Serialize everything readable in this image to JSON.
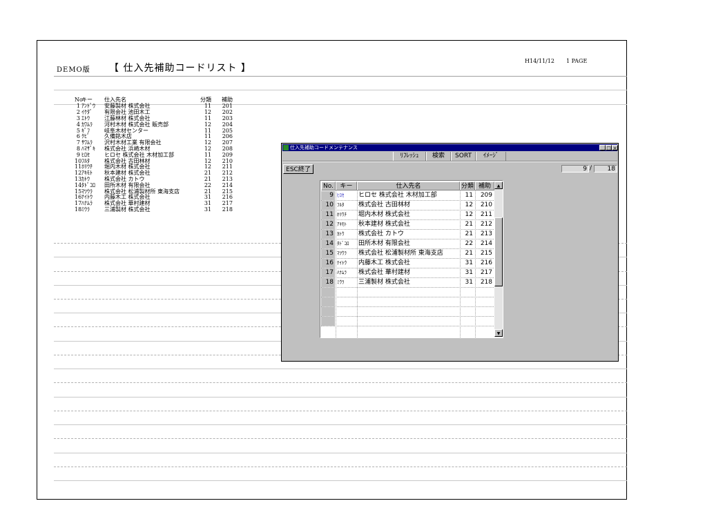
{
  "report": {
    "demo_label": "DEMO版",
    "title": "【 仕入先補助コードリスト 】",
    "date": "H14/11/12",
    "page": "1 PAGE",
    "headers": {
      "no": "No",
      "key": "キー",
      "name": "仕入先名",
      "bunrui": "分類",
      "hojo": "補助"
    },
    "rows": [
      {
        "no": "1",
        "key": "ｱﾝﾄﾞｳ",
        "name": "安藤製材 株式会社",
        "bunrui": "11",
        "hojo": "201"
      },
      {
        "no": "2",
        "key": "ｲｹﾀﾞ",
        "name": "有限会社 池田木工",
        "bunrui": "12",
        "hojo": "202"
      },
      {
        "no": "3",
        "key": "ｴﾄｳ",
        "name": "江藤林材 株式会社",
        "bunrui": "11",
        "hojo": "203"
      },
      {
        "no": "4",
        "key": "ｶﾜﾑﾗ",
        "name": "河村木材 株式会社 販売部",
        "bunrui": "12",
        "hojo": "204"
      },
      {
        "no": "5",
        "key": "ｷﾞﾌ",
        "name": "岐阜木材センター",
        "bunrui": "11",
        "hojo": "205"
      },
      {
        "no": "6",
        "key": "ｸﾋﾞ",
        "name": "久備銘木店",
        "bunrui": "11",
        "hojo": "206"
      },
      {
        "no": "7",
        "key": "ｻﾜﾑﾗ",
        "name": "沢村木材工業 有限会社",
        "bunrui": "12",
        "hojo": "207"
      },
      {
        "no": "8",
        "key": "ﾊﾏｻﾞｷ",
        "name": "株式会社 浜崎木材",
        "bunrui": "12",
        "hojo": "208"
      },
      {
        "no": "9",
        "key": "ﾋﾛｾ",
        "name": "ヒロセ 株式会社 木材加工部",
        "bunrui": "11",
        "hojo": "209"
      },
      {
        "no": "10",
        "key": "ﾌﾙﾀ",
        "name": "株式会社 古田林材",
        "bunrui": "12",
        "hojo": "210"
      },
      {
        "no": "11",
        "key": "ﾎﾘｳﾁ",
        "name": "堀内木材 株式会社",
        "bunrui": "12",
        "hojo": "211"
      },
      {
        "no": "12",
        "key": "ｱｷﾓﾄ",
        "name": "秋本建材 株式会社",
        "bunrui": "21",
        "hojo": "212"
      },
      {
        "no": "13",
        "key": "ｶﾄｳ",
        "name": "株式会社 カトウ",
        "bunrui": "21",
        "hojo": "213"
      },
      {
        "no": "14",
        "key": "ﾀﾄﾞｺﾛ",
        "name": "田所木材 有限会社",
        "bunrui": "22",
        "hojo": "214"
      },
      {
        "no": "15",
        "key": "ﾏﾂｳﾗ",
        "name": "株式会社 松浦製材所 東海支店",
        "bunrui": "21",
        "hojo": "215"
      },
      {
        "no": "16",
        "key": "ﾅｲﾄｳ",
        "name": "内藤木工 株式会社",
        "bunrui": "31",
        "hojo": "216"
      },
      {
        "no": "17",
        "key": "ﾊﾅﾑﾗ",
        "name": "株式会社 華村建材",
        "bunrui": "31",
        "hojo": "217"
      },
      {
        "no": "18",
        "key": "ﾐｳﾗ",
        "name": "三浦製材 株式会社",
        "bunrui": "31",
        "hojo": "218"
      }
    ]
  },
  "window": {
    "title": "仕入先補助コードメンテナンス",
    "buttons": {
      "minimize": "_",
      "maximize": "□",
      "close": "×"
    },
    "toolbar": [
      "ﾘﾌﾚｯｼｭ",
      "検索",
      "SORT",
      "ｲﾒｰｼﾞ"
    ],
    "esc_label": "ESC終了",
    "current": "9",
    "slash": "/",
    "total": "18",
    "grid": {
      "headers": {
        "no": "No.",
        "key": "キー",
        "name": "仕入先名",
        "bunrui": "分類",
        "hojo": "補助"
      },
      "rows": [
        {
          "no": "9",
          "key": "ﾋﾛｾ",
          "name": "ヒロセ 株式会社 木材加工部",
          "bunrui": "11",
          "hojo": "209"
        },
        {
          "no": "10",
          "key": "ﾌﾙﾀ",
          "name": "株式会社 古田林材",
          "bunrui": "12",
          "hojo": "210"
        },
        {
          "no": "11",
          "key": "ﾎﾘｳﾁ",
          "name": "堀内木材 株式会社",
          "bunrui": "12",
          "hojo": "211"
        },
        {
          "no": "12",
          "key": "ｱｷﾓﾄ",
          "name": "秋本建材 株式会社",
          "bunrui": "21",
          "hojo": "212"
        },
        {
          "no": "13",
          "key": "ｶﾄｳ",
          "name": "株式会社 カトウ",
          "bunrui": "21",
          "hojo": "213"
        },
        {
          "no": "14",
          "key": "ﾀﾄﾞｺﾛ",
          "name": "田所木材 有限会社",
          "bunrui": "22",
          "hojo": "214"
        },
        {
          "no": "15",
          "key": "ﾏﾂｳﾗ",
          "name": "株式会社 松浦製材所 東海支店",
          "bunrui": "21",
          "hojo": "215"
        },
        {
          "no": "16",
          "key": "ﾅｲﾄｳ",
          "name": "内藤木工 株式会社",
          "bunrui": "31",
          "hojo": "216"
        },
        {
          "no": "17",
          "key": "ﾊﾅﾑﾗ",
          "name": "株式会社 華村建材",
          "bunrui": "31",
          "hojo": "217"
        },
        {
          "no": "18",
          "key": "ﾐｳﾗ",
          "name": "三浦製材 株式会社",
          "bunrui": "31",
          "hojo": "218"
        }
      ],
      "blank_rows": 4
    },
    "scroll": {
      "up": "▲",
      "down": "▼"
    }
  }
}
